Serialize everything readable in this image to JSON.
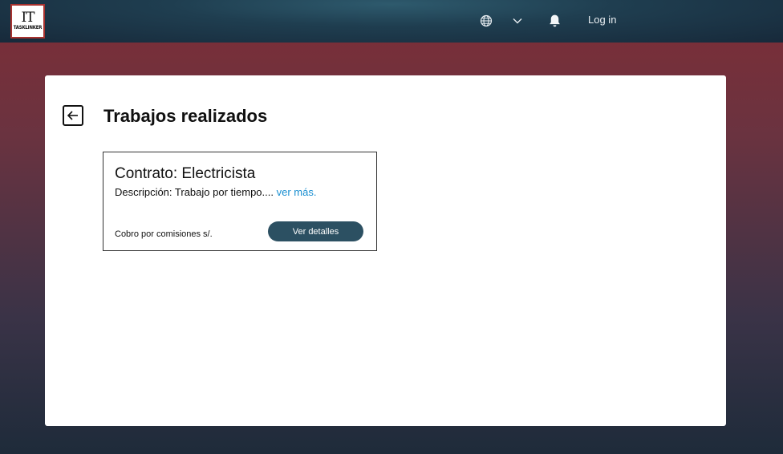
{
  "brand": {
    "logo_mark": "IT",
    "logo_word": "TASKLINKER"
  },
  "header": {
    "language_icon": "globe-icon",
    "dropdown_icon": "chevron-down-icon",
    "notifications_icon": "bell-icon",
    "login_label": "Log in"
  },
  "main": {
    "back_icon": "arrow-left-icon",
    "title": "Trabajos realizados",
    "cards": [
      {
        "title": "Contrato: Electricista",
        "description": "Descripción: Trabajo por tiempo.... ",
        "more_link": "ver más.",
        "fee_label": "Cobro por comisiones s/.",
        "details_button": "Ver detalles"
      }
    ]
  },
  "colors": {
    "header_bg": "#1f3e50",
    "button_bg": "#2c5062",
    "link": "#1a8fd1",
    "logo_border": "#a8322f"
  }
}
